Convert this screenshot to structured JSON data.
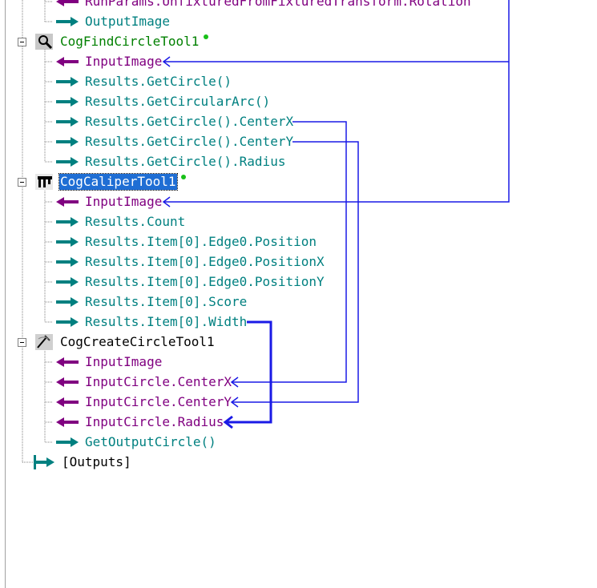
{
  "tree": {
    "rows": [
      {
        "label": "RunParams.UnfixturedFromFixturedTransform.Rotation",
        "kind": "in"
      },
      {
        "label": "OutputImage",
        "kind": "out"
      },
      {
        "label": "CogFindCircleTool1",
        "kind": "tool"
      },
      {
        "label": "InputImage",
        "kind": "in"
      },
      {
        "label": "Results.GetCircle()",
        "kind": "out"
      },
      {
        "label": "Results.GetCircularArc()",
        "kind": "out"
      },
      {
        "label": "Results.GetCircle().CenterX",
        "kind": "out"
      },
      {
        "label": "Results.GetCircle().CenterY",
        "kind": "out"
      },
      {
        "label": "Results.GetCircle().Radius",
        "kind": "out"
      },
      {
        "label": "CogCaliperTool1",
        "kind": "tool",
        "selected": true
      },
      {
        "label": "InputImage",
        "kind": "in"
      },
      {
        "label": "Results.Count",
        "kind": "out"
      },
      {
        "label": "Results.Item[0].Edge0.Position",
        "kind": "out"
      },
      {
        "label": "Results.Item[0].Edge0.PositionX",
        "kind": "out"
      },
      {
        "label": "Results.Item[0].Edge0.PositionY",
        "kind": "out"
      },
      {
        "label": "Results.Item[0].Score",
        "kind": "out"
      },
      {
        "label": "Results.Item[0].Width",
        "kind": "out"
      },
      {
        "label": "CogCreateCircleTool1",
        "kind": "tool"
      },
      {
        "label": "InputImage",
        "kind": "in"
      },
      {
        "label": "InputCircle.CenterX",
        "kind": "in"
      },
      {
        "label": "InputCircle.CenterY",
        "kind": "in"
      },
      {
        "label": "InputCircle.Radius",
        "kind": "in"
      },
      {
        "label": "GetOutputCircle()",
        "kind": "out"
      },
      {
        "label": "[Outputs]",
        "kind": "outputs"
      }
    ]
  },
  "colors": {
    "input": "#800080",
    "output": "#008080",
    "tool": "#008000",
    "selection": "#1f6ed4",
    "link": "#1a1ae6",
    "modified_dot": "#18c018"
  },
  "icons": {
    "input_arrow": "left-arrow-icon",
    "output_arrow": "right-arrow-icon",
    "find_circle": "magnifier-icon",
    "caliper": "caliper-icon",
    "create_circle": "create-circle-icon",
    "outputs": "outputs-terminal-icon"
  }
}
